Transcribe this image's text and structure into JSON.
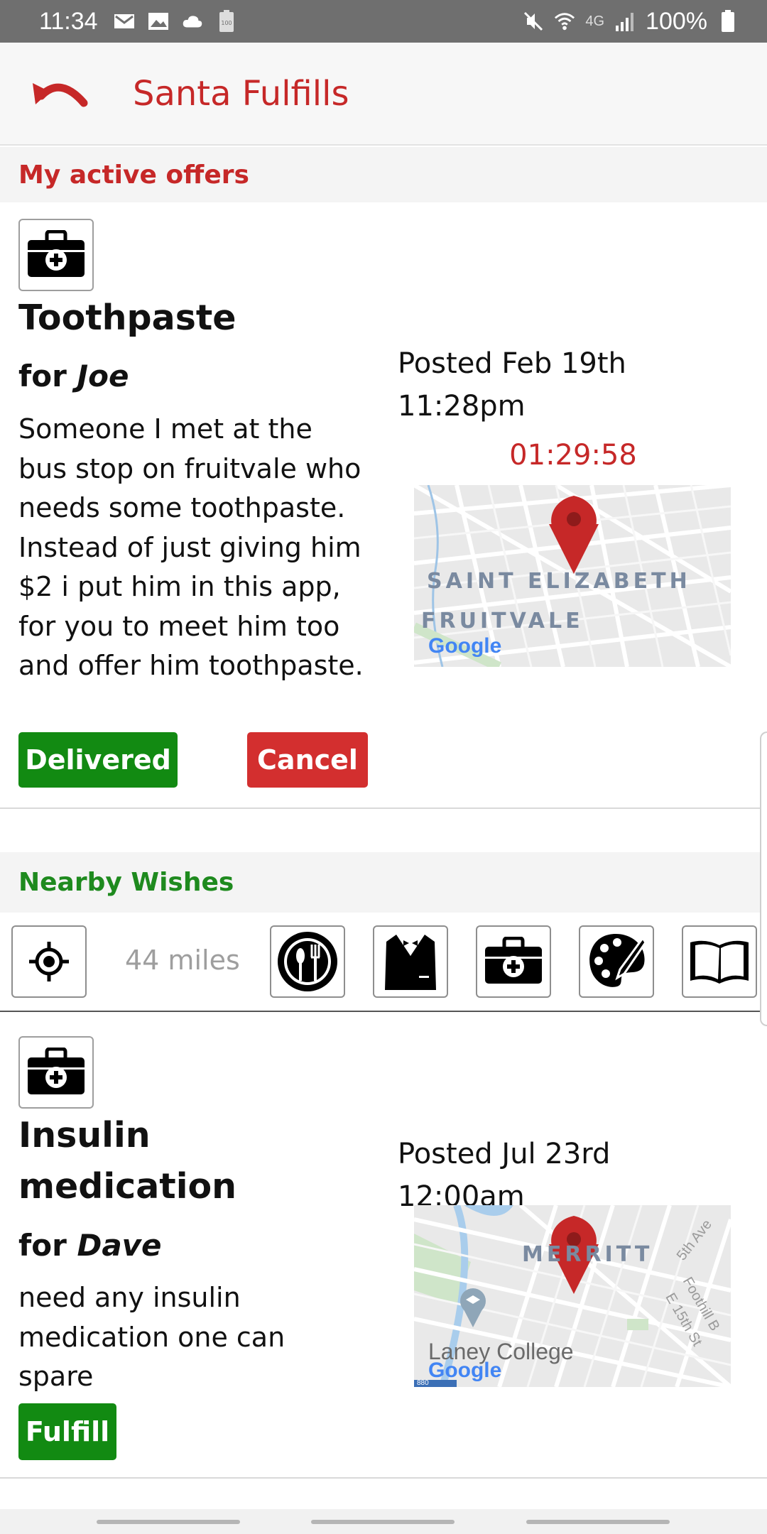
{
  "status_bar": {
    "time": "11:34",
    "battery_level_text": "100",
    "network": "4G",
    "battery": "100%"
  },
  "app_bar": {
    "title": "Santa Fulfills",
    "back_icon": "undo-arrow-icon"
  },
  "active_offers": {
    "heading": "My active offers",
    "offer": {
      "category_icon": "medkit-icon",
      "title": "Toothpaste",
      "for_prefix": "for",
      "for_name": "Joe",
      "description": "Someone I met at the bus stop on fruitvale who needs some toothpaste. Instead of just giving him $2 i put him in this app, for you to meet him too and offer him toothpaste.",
      "posted_line1": "Posted Feb 19th",
      "posted_line2": "11:28pm",
      "timer": "01:29:58",
      "map_labels": [
        "SAINT ELIZABETH",
        "FRUITVALE"
      ],
      "map_brand": "Google",
      "delivered_label": "Delivered",
      "cancel_label": "Cancel"
    }
  },
  "nearby": {
    "heading": "Nearby Wishes",
    "distance": "44 miles",
    "filters": [
      {
        "icon": "location-target-icon"
      },
      {
        "icon": "food-icon"
      },
      {
        "icon": "clothing-icon"
      },
      {
        "icon": "medkit-icon"
      },
      {
        "icon": "art-palette-icon"
      },
      {
        "icon": "book-icon"
      }
    ],
    "wish": {
      "category_icon": "medkit-icon",
      "title_line1": "Insulin",
      "title_line2": "medication",
      "for_prefix": "for",
      "for_name": "Dave",
      "description": "need any insulin medication one can spare",
      "posted_line1": "Posted Jul 23rd",
      "posted_line2": "12:00am",
      "map_labels": [
        "MERRITT",
        "Laney College",
        "5th Ave",
        "Foothill B",
        "E 15th St"
      ],
      "map_brand": "Google",
      "map_shield": "880",
      "fulfill_label": "Fulfill"
    }
  },
  "colors": {
    "accent_red": "#c62828",
    "accent_green": "#128a12",
    "status_bar": "#6f6f6f"
  }
}
